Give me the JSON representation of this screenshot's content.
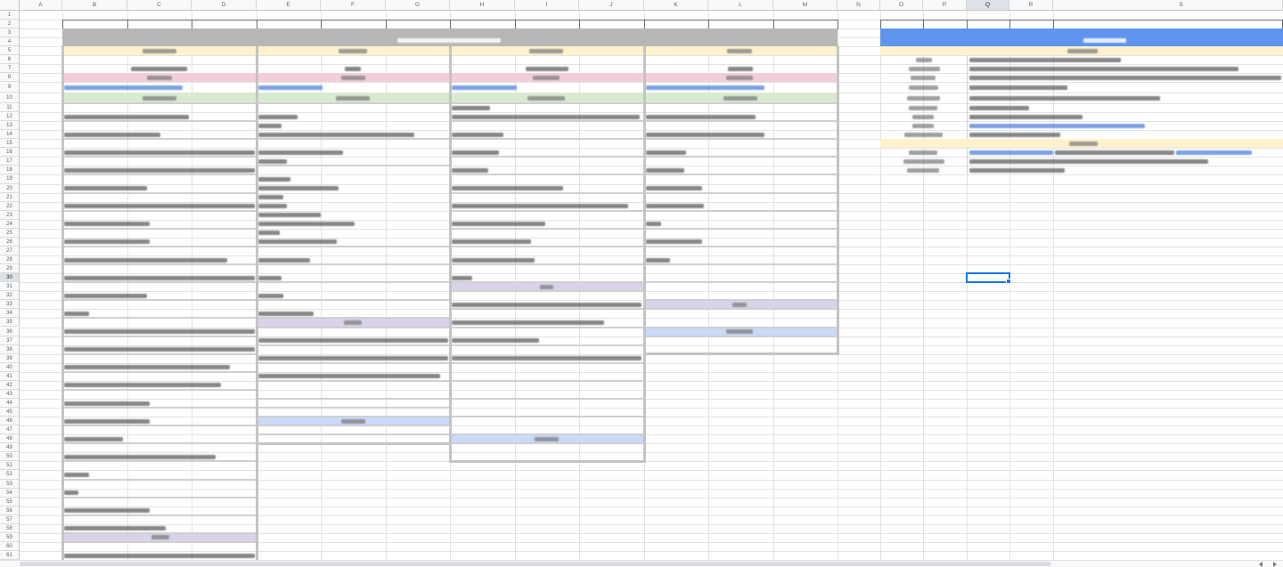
{
  "sheet": {
    "columns": [
      "A",
      "B",
      "C",
      "D",
      "E",
      "F",
      "G",
      "H",
      "I",
      "J",
      "K",
      "L",
      "M",
      "N",
      "O",
      "P",
      "Q",
      "R",
      "S"
    ],
    "rows": [
      "1",
      "2",
      "3",
      "4",
      "5",
      "6",
      "7",
      "8",
      "9",
      "10",
      "11",
      "12",
      "13",
      "14",
      "15",
      "16",
      "17",
      "18",
      "19",
      "20",
      "21",
      "22",
      "23",
      "24",
      "25",
      "26",
      "27",
      "28",
      "29",
      "30",
      "31",
      "32",
      "33",
      "34",
      "35",
      "36",
      "37",
      "38",
      "39",
      "40",
      "41",
      "42",
      "43",
      "44",
      "45",
      "46",
      "47",
      "48",
      "49",
      "50",
      "51",
      "52",
      "53",
      "54",
      "55",
      "56",
      "57",
      "58",
      "59",
      "60",
      "61"
    ]
  },
  "scrollbar": {
    "left_icon": "chevron-left-icon",
    "right_icon": "chevron-right-icon"
  },
  "colors": {
    "header_gray": "#b7b7b7",
    "header_blue": "#5f95ee",
    "band_yellow": "#fff2cc",
    "band_pink": "#f2cfd8",
    "band_green": "#d9ead3",
    "band_purple": "#d9d2e9",
    "band_blue": "#c9daf8",
    "text": "#595959",
    "label": "#7b7b7b",
    "link": "#1155cc",
    "selection": "#1a73e8"
  }
}
